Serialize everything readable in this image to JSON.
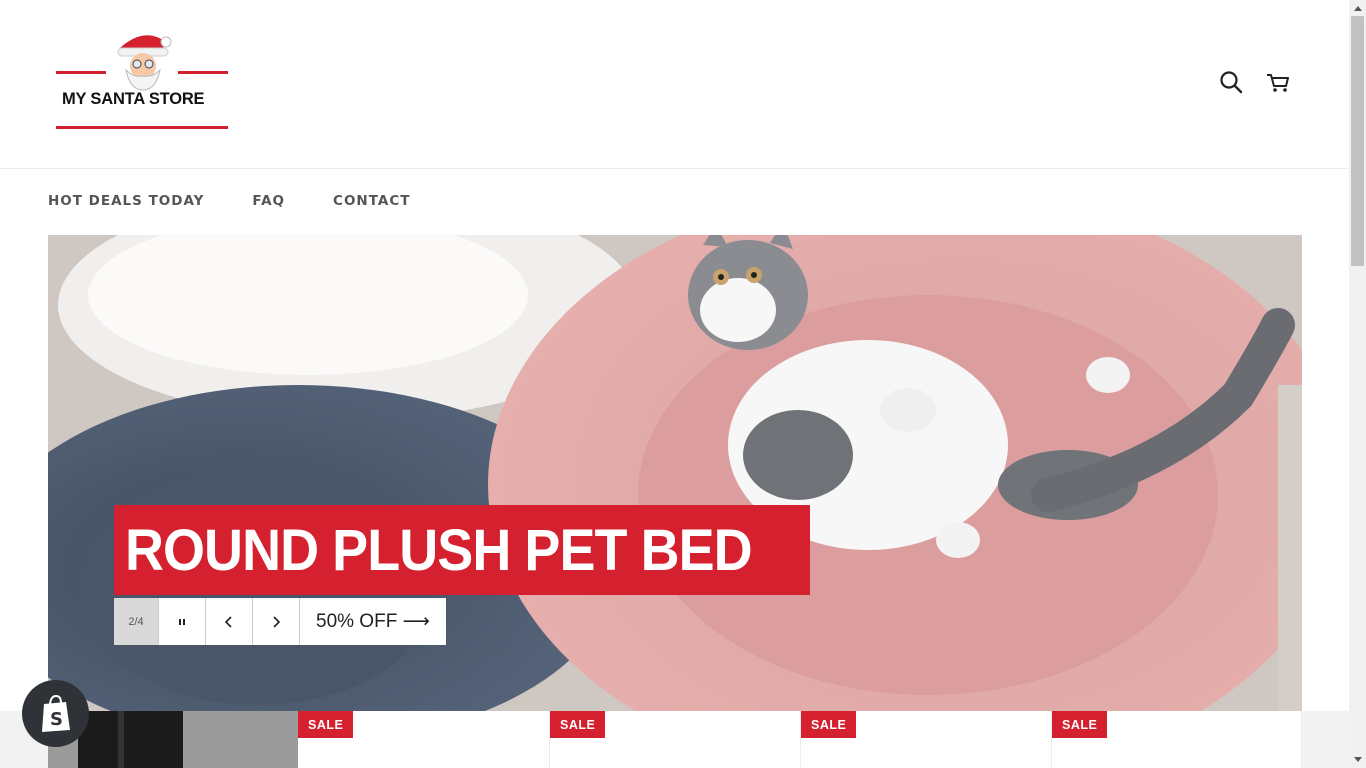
{
  "store": {
    "name": "MY SANTA STORE",
    "logo_icon": "santa-face-icon"
  },
  "header": {
    "search_icon": "search-icon",
    "cart_icon": "cart-icon"
  },
  "nav": {
    "items": [
      {
        "label": "HOT DEALS TODAY"
      },
      {
        "label": "FAQ"
      },
      {
        "label": "CONTACT"
      }
    ]
  },
  "hero": {
    "title": "ROUND PLUSH PET BED",
    "counter": "2/4",
    "pause_icon": "pause-icon",
    "prev_icon": "chevron-left-icon",
    "next_icon": "chevron-right-icon",
    "link_label": "50% OFF ⟶"
  },
  "products": {
    "badges": [
      {
        "label": "SALE"
      },
      {
        "label": "SALE"
      },
      {
        "label": "SALE"
      },
      {
        "label": "SALE"
      }
    ]
  },
  "colors": {
    "accent": "#d4202f",
    "nav_text": "#555555",
    "badge_dark": "#2f3337"
  }
}
